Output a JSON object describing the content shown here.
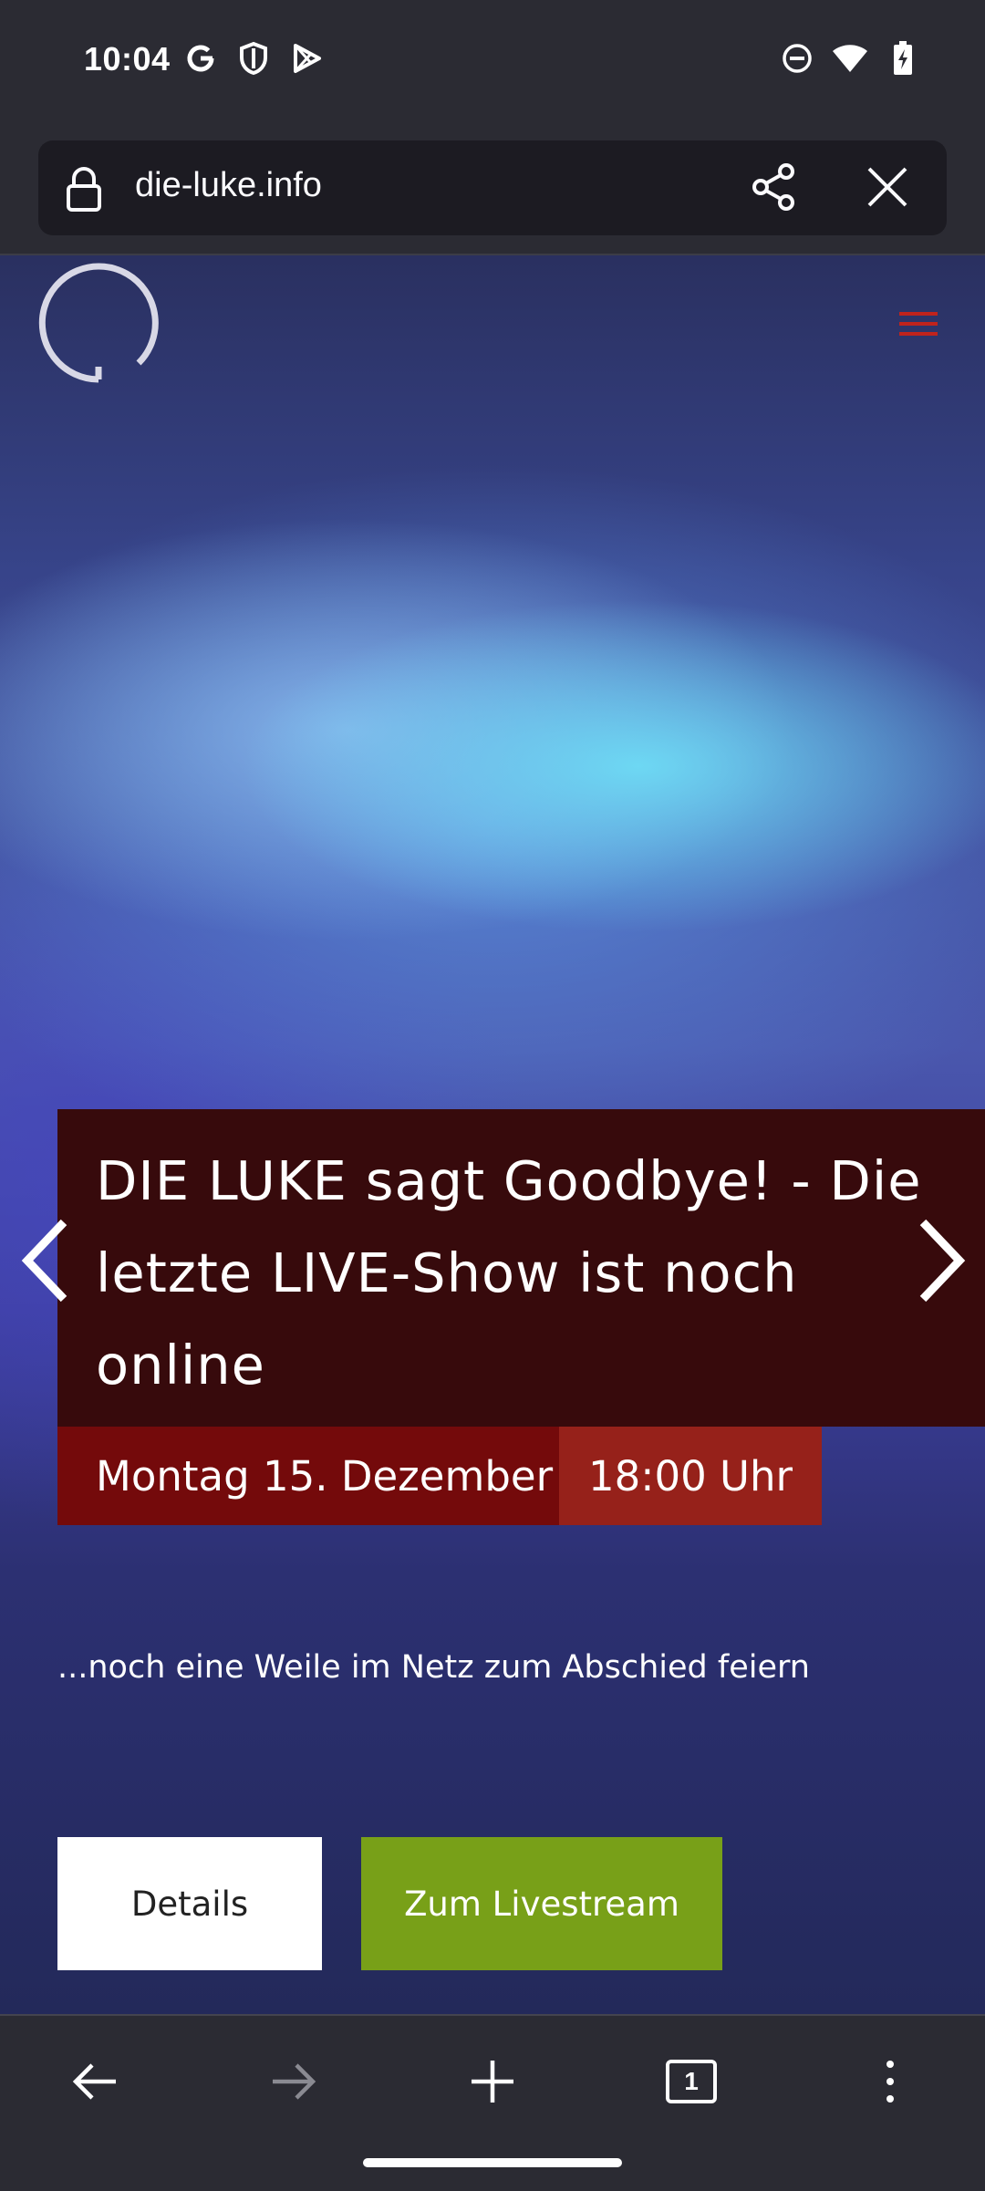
{
  "status_bar": {
    "time": "10:04",
    "left_icons": [
      "google-icon",
      "vpn-shield-icon",
      "play-store-icon"
    ],
    "right_icons": [
      "dnd-icon",
      "wifi-icon",
      "battery-charging-icon"
    ]
  },
  "browser": {
    "url": "die-luke.info",
    "tab_count": "1"
  },
  "hero": {
    "headline": "DIE LUKE sagt Goodbye! - Die letzte LIVE-Show ist noch online",
    "date": "Montag  15. Dezember",
    "time": "18:00 Uhr",
    "subtitle": "...noch eine Weile im Netz zum Abschied feiern",
    "details_label": "Details",
    "livestream_label": "Zum Livestream"
  },
  "colors": {
    "headline_bg": "#370a0c",
    "date_bg": "#740a0b",
    "time_bg": "#96211a",
    "livestream_bg": "#78a018",
    "menu_accent": "#c0231c"
  }
}
